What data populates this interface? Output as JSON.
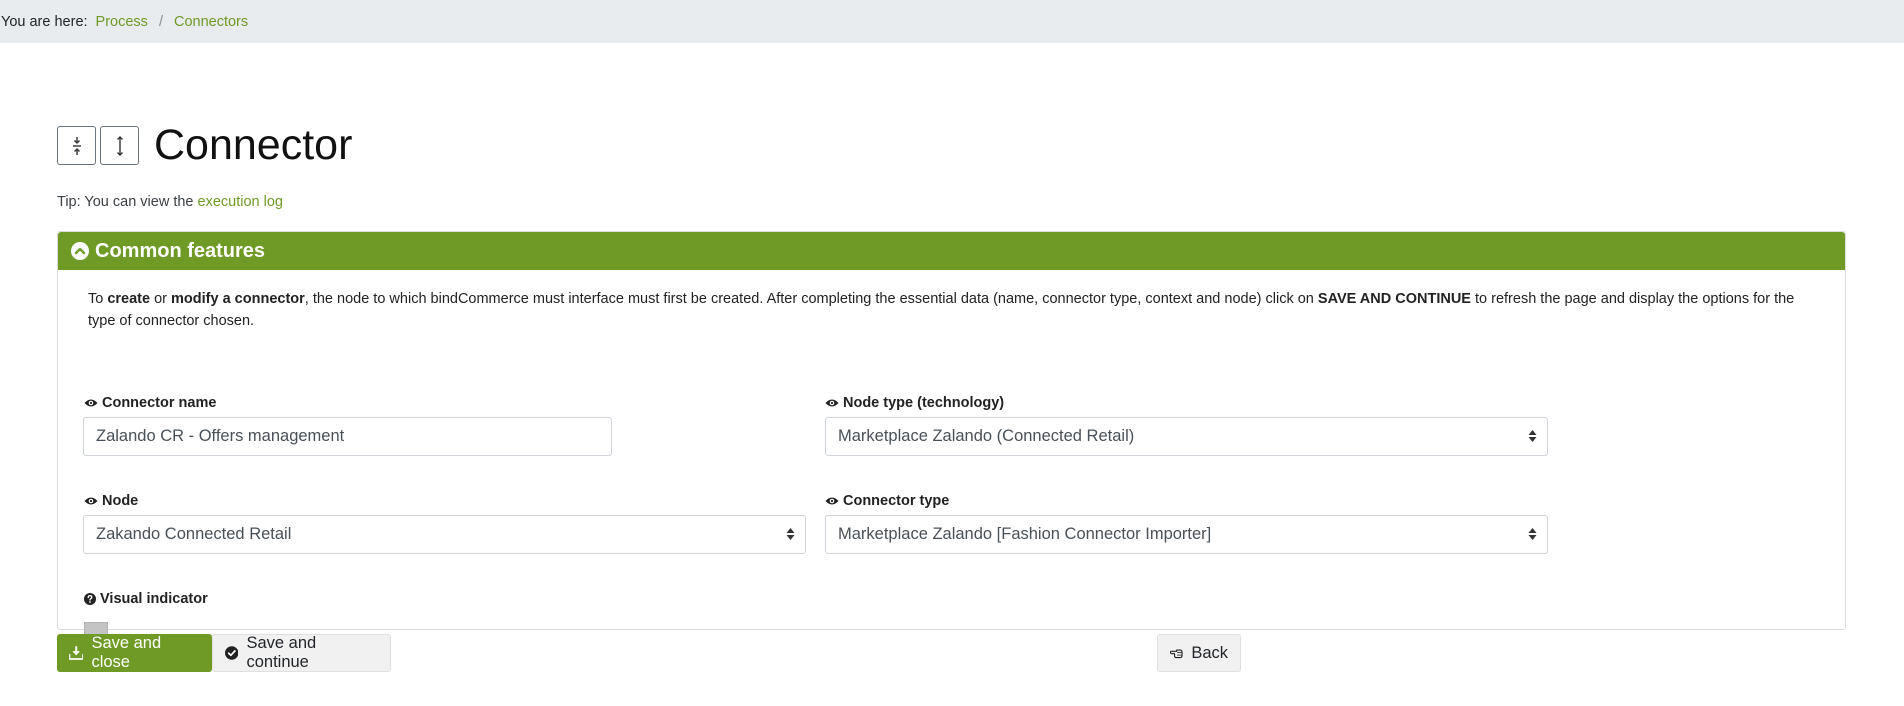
{
  "breadcrumb": {
    "lead": "You are here:",
    "items": [
      "Process",
      "Connectors"
    ],
    "separator": "/"
  },
  "header": {
    "title": "Connector"
  },
  "tip": {
    "prefix": "Tip: You can view the",
    "link": "execution log"
  },
  "card": {
    "title": "Common features",
    "intro": {
      "p1": "To ",
      "b1": "create",
      "p2": " or ",
      "b2": "modify a connector",
      "p3": ", the node to which bindCommerce must interface must first be created. After completing the essential data (name, connector type, context and node) click on ",
      "b3": "SAVE AND CONTINUE",
      "p4": " to refresh the page and display the options for the type of connector chosen."
    },
    "fields": {
      "connector_name": {
        "label": "Connector name",
        "value": "Zalando CR - Offers management"
      },
      "node_type": {
        "label": "Node type (technology)",
        "value": "Marketplace Zalando (Connected Retail)"
      },
      "node": {
        "label": "Node",
        "value": "Zakando Connected Retail"
      },
      "connector_type": {
        "label": "Connector type",
        "value": "Marketplace Zalando [Fashion Connector Importer]"
      },
      "visual_indicator": {
        "label": "Visual indicator",
        "color": "#c4c4c4"
      }
    }
  },
  "actions": {
    "save_close": "Save and close",
    "save_continue": "Save and continue",
    "back": "Back"
  },
  "colors": {
    "accent": "#6f9a25",
    "breadcrumb_bg": "#e9ecef"
  }
}
